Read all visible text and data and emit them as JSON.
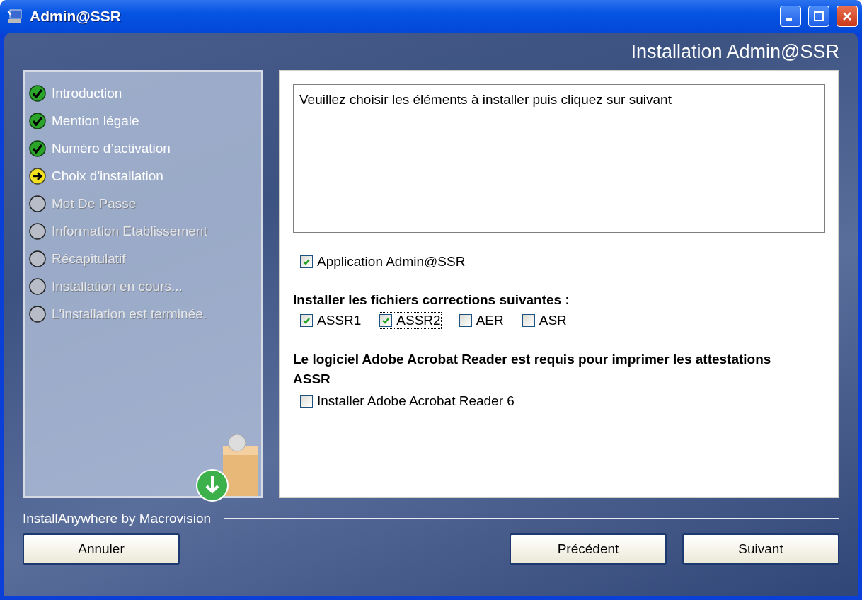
{
  "window": {
    "title": "Admin@SSR"
  },
  "header": {
    "title": "Installation Admin@SSR"
  },
  "steps": [
    {
      "label": "Introduction",
      "kind": "done"
    },
    {
      "label": "Mention légale",
      "kind": "done"
    },
    {
      "label": "Numéro d’activation",
      "kind": "done"
    },
    {
      "label": "Choix d'installation",
      "kind": "current"
    },
    {
      "label": "Mot De Passe",
      "kind": "pending"
    },
    {
      "label": "Information Etablissement",
      "kind": "pending"
    },
    {
      "label": "Récapitulatif",
      "kind": "pending"
    },
    {
      "label": "Installation en cours...",
      "kind": "pending"
    },
    {
      "label": "L'installation est terminée.",
      "kind": "pending"
    }
  ],
  "instructions": "Veuillez choisir les éléments à installer puis cliquez sur suivant",
  "application_option": {
    "label": "Application Admin@SSR",
    "checked": true,
    "focused": false
  },
  "corrections": {
    "heading": "Installer les fichiers corrections suivantes :",
    "options": [
      {
        "label": "ASSR1",
        "checked": true,
        "focused": false
      },
      {
        "label": "ASSR2",
        "checked": true,
        "focused": true
      },
      {
        "label": "AER",
        "checked": false,
        "focused": false
      },
      {
        "label": "ASR",
        "checked": false,
        "focused": false
      }
    ]
  },
  "reader": {
    "heading": "Le logiciel Adobe Acrobat Reader est requis pour imprimer les attestations ASSR",
    "option": {
      "label": "Installer Adobe Acrobat Reader 6",
      "checked": false,
      "focused": false
    }
  },
  "footer": {
    "brand": "InstallAnywhere by Macrovision"
  },
  "buttons": {
    "cancel": "Annuler",
    "back": "Précédent",
    "next": "Suivant"
  }
}
